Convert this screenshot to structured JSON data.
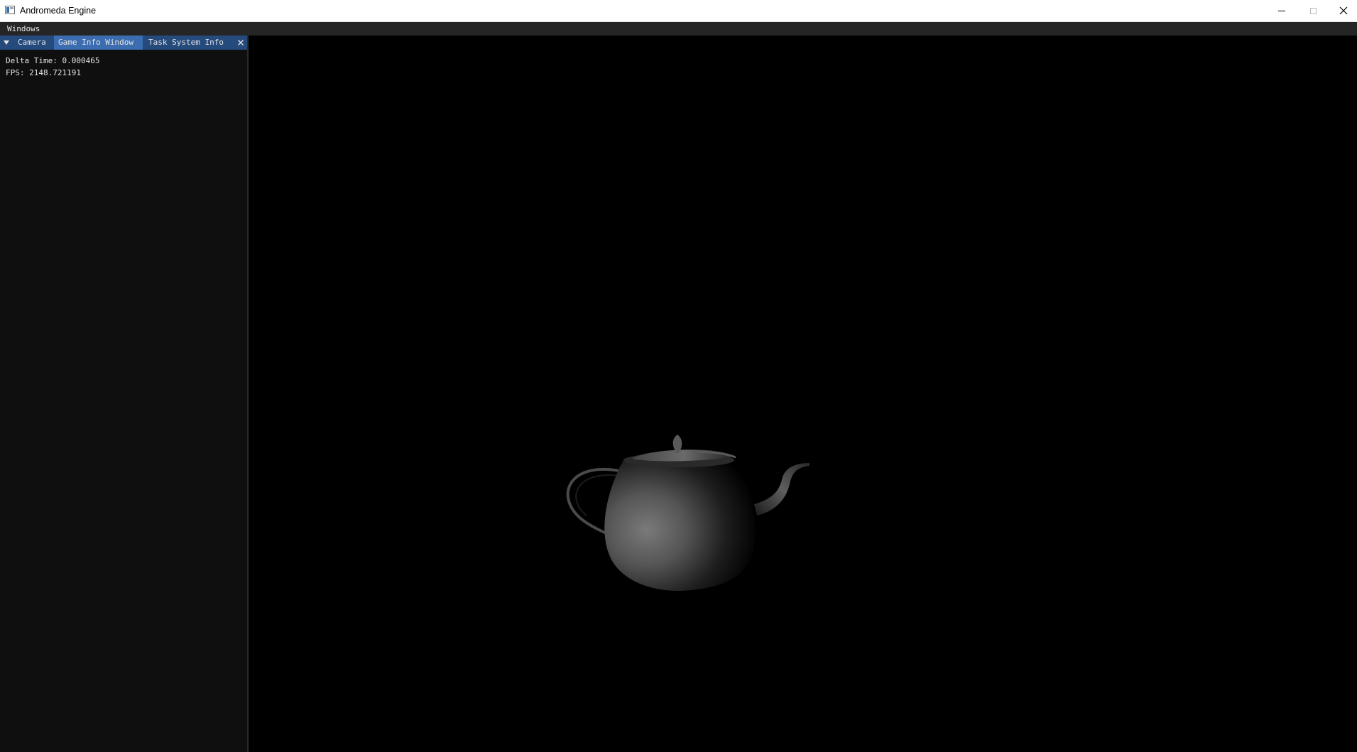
{
  "window": {
    "title": "Andromeda Engine",
    "app_icon": "app-window-icon",
    "controls": [
      "minimize-icon",
      "maximize-icon",
      "close-icon"
    ]
  },
  "menubar": {
    "items": [
      {
        "label": "Windows"
      }
    ]
  },
  "dock_panel": {
    "menu_icon": "triangle-down-icon",
    "tabs": [
      {
        "label": "Camera",
        "active": false
      },
      {
        "label": "Game Info Window",
        "active": true
      },
      {
        "label": "Task System Info",
        "active": false
      }
    ],
    "close_icon": "close-icon",
    "lines": [
      "Delta Time: 0.000465",
      "FPS: 2148.721191"
    ]
  },
  "viewport": {
    "content": "teapot-render"
  },
  "colors": {
    "titlebar_bg": "#ffffff",
    "menubar_bg": "#252525",
    "panel_bg": "#0f0f0f",
    "tabbar_bg": "#254a7c",
    "active_tab_bg": "#3b6db0",
    "text": "#e6e6e6",
    "viewport_bg": "#000000"
  }
}
